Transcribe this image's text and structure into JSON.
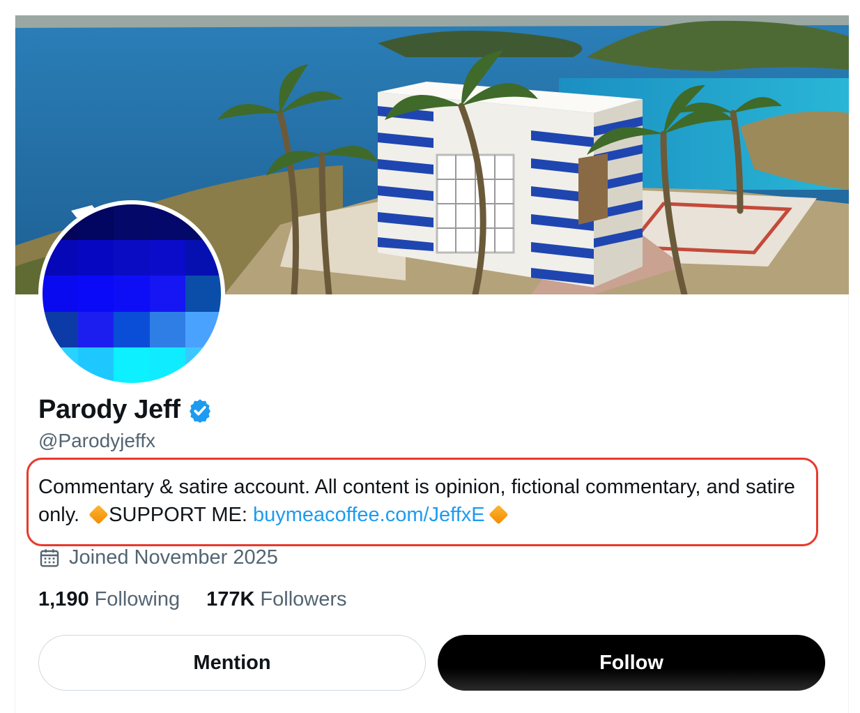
{
  "profile": {
    "name": "Parody Jeff",
    "verified": true,
    "handle": "@Parodyjeffx",
    "bio_text": "Commentary & satire account. All content is opinion, fictional commentary, and satire only.",
    "bio_support_label": "SUPPORT ME:",
    "bio_link": "buymeacoffee.com/JeffxE",
    "joined": "Joined November 2025",
    "following_count": "1,190",
    "following_label": "Following",
    "followers_count": "177K",
    "followers_label": "Followers"
  },
  "actions": {
    "mention_label": "Mention",
    "follow_label": "Follow"
  },
  "icons": {
    "verified": "verified-badge-icon",
    "calendar": "calendar-icon",
    "bio_emoji": "orange-diamond-icon"
  },
  "colors": {
    "link": "#1d9bf0",
    "secondary_text": "#536471",
    "verified": "#1d9bf0",
    "highlight_box": "#e8392b",
    "follow_button": "#000000"
  },
  "avatar_pixels": [
    "#04055a",
    "#030660",
    "#040868",
    "#04086a",
    "#020a68",
    "#0608b8",
    "#0508c0",
    "#0a0cc4",
    "#0b0cc9",
    "#0610b0",
    "#0a0af0",
    "#0a0af8",
    "#0e0ef6",
    "#1616f4",
    "#0a4eaa",
    "#0c3aa6",
    "#1c1ef0",
    "#0a4ed8",
    "#2f7ee6",
    "#4aa2ff",
    "#2ad2ff",
    "#1ec8ff",
    "#0cf0ff",
    "#10ecff",
    "#3cc8ff"
  ]
}
